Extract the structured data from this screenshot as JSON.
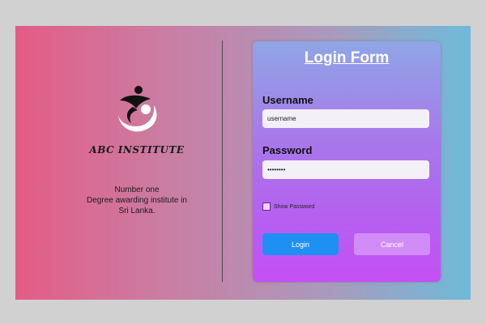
{
  "brand": {
    "name": "ABC INSTITUTE",
    "tagline": [
      "Number one",
      "Degree awarding institute in",
      "Sri Lanka."
    ]
  },
  "form": {
    "title": "Login Form",
    "username_label": "Username",
    "username_value": "username",
    "password_label": "Password",
    "password_value": "••••••••",
    "show_password_label": "Show Password",
    "login_label": "Login",
    "cancel_label": "Cancel"
  },
  "colors": {
    "login_button": "#1f90f3",
    "cancel_button": "#d28cf7"
  }
}
